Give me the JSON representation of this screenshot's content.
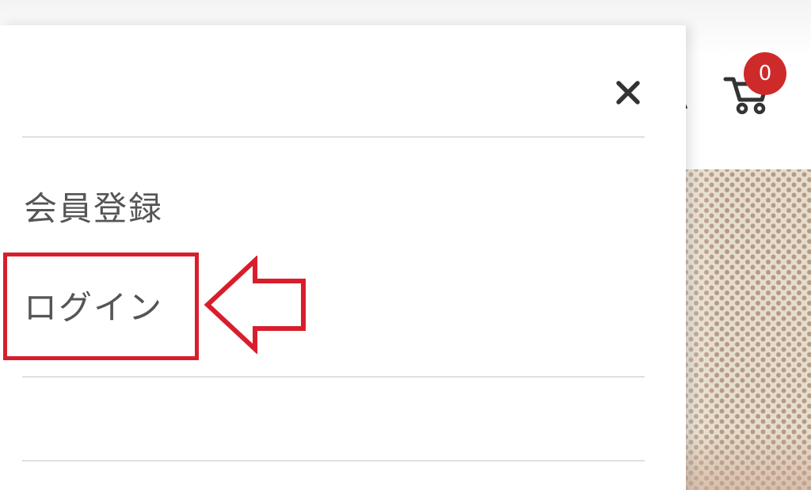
{
  "cart": {
    "count": "0",
    "icon": "cart-icon",
    "badge_color": "#cf2a2a"
  },
  "drawer": {
    "close_icon": "close-icon",
    "menu_items": [
      {
        "label": "会員登録"
      },
      {
        "label": "ログイン"
      }
    ]
  },
  "annotation": {
    "color": "#d81e2c",
    "arrow_icon": "left-arrow-icon"
  }
}
